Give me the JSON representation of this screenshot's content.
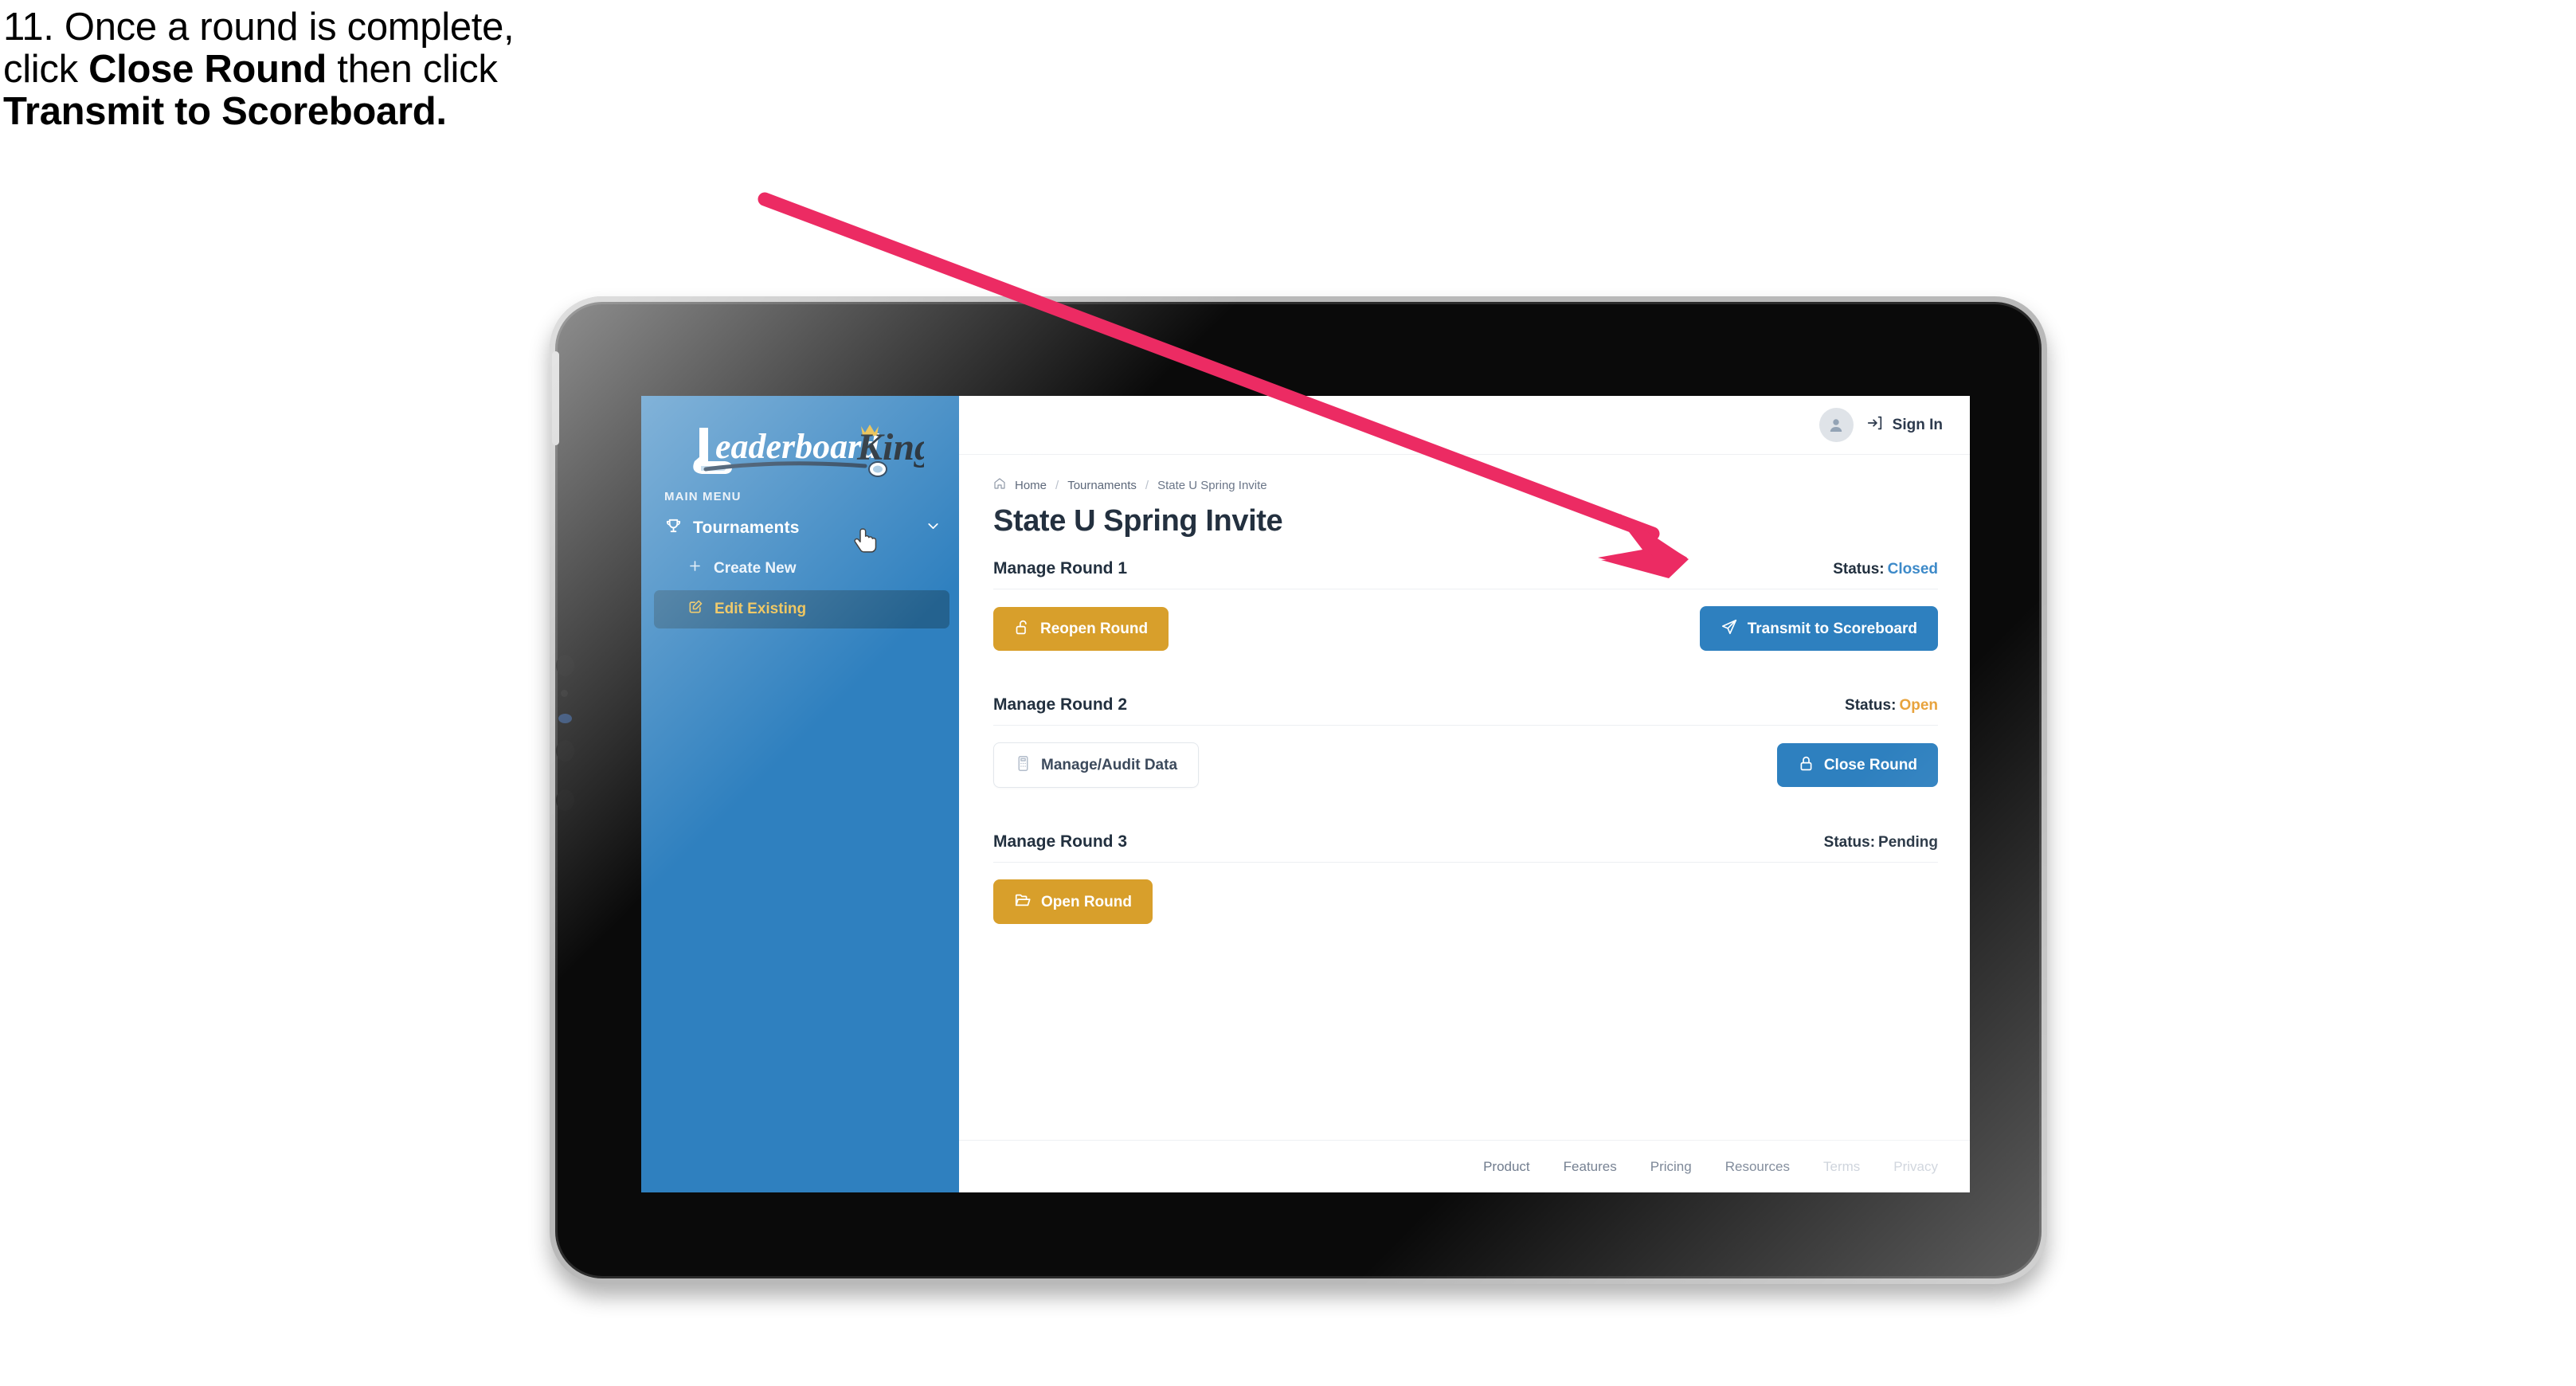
{
  "caption": {
    "line1_plain": "11. Once a round is complete,",
    "line2_pre": "click ",
    "line2_bold": "Close Round",
    "line2_post": " then click",
    "line3_bold": "Transmit to Scoreboard."
  },
  "app": {
    "logo_primary": "Leaderboard",
    "logo_secondary": "King"
  },
  "sidebar": {
    "menu_label": "MAIN MENU",
    "nav": {
      "label": "Tournaments",
      "icon": "trophy-icon",
      "chevron": "chevron-down-icon"
    },
    "items": [
      {
        "label": "Create New",
        "icon": "plus-icon",
        "active": false
      },
      {
        "label": "Edit Existing",
        "icon": "edit-square-icon",
        "active": true
      }
    ]
  },
  "topbar": {
    "avatar_icon": "user-avatar-icon",
    "signin_icon": "sign-in-arrow-icon",
    "signin_label": "Sign In"
  },
  "breadcrumb": {
    "home_icon": "home-icon",
    "items": [
      "Home",
      "Tournaments",
      "State U Spring Invite"
    ],
    "separator": "/"
  },
  "page": {
    "title": "State U Spring Invite"
  },
  "rounds": [
    {
      "title": "Manage Round 1",
      "status_label": "Status:",
      "status_value": "Closed",
      "status_class": "status-closed",
      "left_button": {
        "label": "Reopen Round",
        "icon": "unlock-icon",
        "style": "btn-gold"
      },
      "right_button": {
        "label": "Transmit to Scoreboard",
        "icon": "paper-plane-icon",
        "style": "btn-blue"
      }
    },
    {
      "title": "Manage Round 2",
      "status_label": "Status:",
      "status_value": "Open",
      "status_class": "status-open",
      "left_button": {
        "label": "Manage/Audit Data",
        "icon": "calculator-icon",
        "style": "btn-ghost"
      },
      "right_button": {
        "label": "Close Round",
        "icon": "lock-icon",
        "style": "btn-blue"
      }
    },
    {
      "title": "Manage Round 3",
      "status_label": "Status:",
      "status_value": "Pending",
      "status_class": "status-pending",
      "left_button": {
        "label": "Open Round",
        "icon": "open-folder-icon",
        "style": "btn-gold"
      },
      "right_button": null
    }
  ],
  "footer": {
    "links": [
      {
        "label": "Product",
        "muted": false
      },
      {
        "label": "Features",
        "muted": false
      },
      {
        "label": "Pricing",
        "muted": false
      },
      {
        "label": "Resources",
        "muted": false
      },
      {
        "label": "Terms",
        "muted": true
      },
      {
        "label": "Privacy",
        "muted": true
      }
    ]
  },
  "annotation": {
    "arrow_color": "#ec2b63",
    "target": "transmit-to-scoreboard-button"
  },
  "colors": {
    "sidebar_blue": "#2f80bf",
    "sidebar_active": "#24628f",
    "active_text_gold": "#edc04f",
    "button_gold": "#d89f2b",
    "button_blue": "#2e80bf",
    "status_closed": "#3d8ac9",
    "status_open": "#e8a33d",
    "arrow_pink": "#ec2b63"
  }
}
